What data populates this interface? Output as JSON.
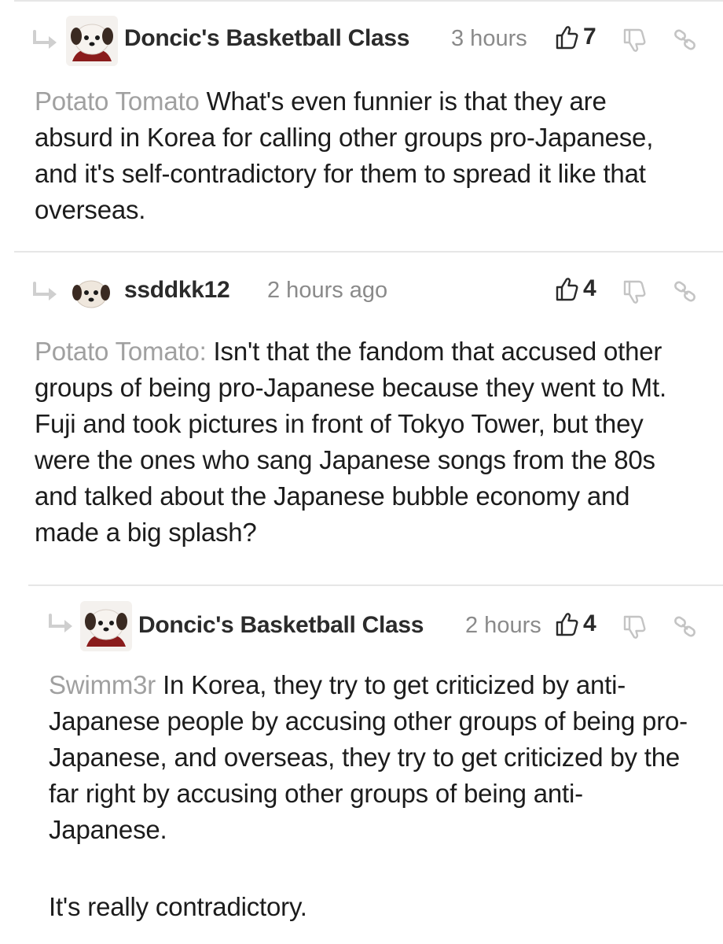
{
  "comments": [
    {
      "username": "Doncic's Basketball Class",
      "time": "3 hours",
      "likes": "7",
      "mention": "Potato Tomato",
      "text": "What's even funnier is that they are absurd in Korea for calling other groups pro-Japanese, and it's self-contradictory for them to spread it like that overseas.",
      "avatar_icon": "puppy-avatar-icon"
    },
    {
      "username": "ssddkk12",
      "time": "2 hours ago",
      "likes": "4",
      "mention": "Potato Tomato:",
      "text": "Isn't that the fandom that accused other groups of being pro-Japanese because they went to Mt. Fuji and took pictures in front of Tokyo Tower, but they were the ones who sang Japanese songs from the 80s and talked about the Japanese bubble economy and made a big splash?",
      "avatar_icon": "puppy-avatar-icon"
    },
    {
      "username": "Doncic's Basketball Class",
      "time": "2 hours",
      "likes": "4",
      "mention": "Swimm3r",
      "text": "In Korea, they try to get criticized by anti-Japanese people by accusing other groups of being pro-Japanese, and overseas, they try to get criticized by the far right by accusing other groups of being anti-Japanese.",
      "text2": "It's really contradictory.",
      "avatar_icon": "puppy-avatar-icon"
    }
  ],
  "icons": {
    "reply": "reply-arrow-icon",
    "like": "thumbs-up-icon",
    "dislike": "thumbs-down-icon",
    "link": "link-icon"
  },
  "colors": {
    "text": "#1c1c1c",
    "muted": "#8a8a8a",
    "mention": "#a0a0a0",
    "icon": "#c4c4c4",
    "divider": "#e6e6e6"
  }
}
